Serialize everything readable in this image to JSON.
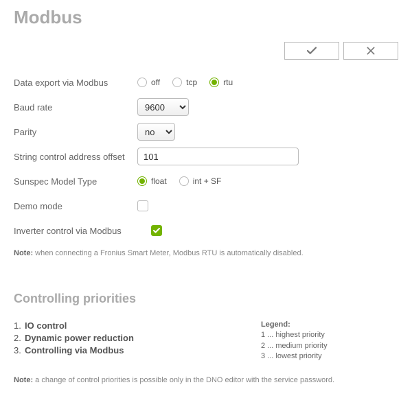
{
  "title": "Modbus",
  "toolbar": {
    "apply_label": "apply",
    "cancel_label": "cancel"
  },
  "form": {
    "data_export": {
      "label": "Data export via Modbus",
      "options": {
        "off": "off",
        "tcp": "tcp",
        "rtu": "rtu"
      },
      "value": "rtu"
    },
    "baud_rate": {
      "label": "Baud rate",
      "value": "9600"
    },
    "parity": {
      "label": "Parity",
      "value": "no"
    },
    "string_offset": {
      "label": "String control address offset",
      "value": "101"
    },
    "sunspec": {
      "label": "Sunspec Model Type",
      "options": {
        "float": "float",
        "intsf": "int + SF"
      },
      "value": "float"
    },
    "demo_mode": {
      "label": "Demo mode",
      "value": false
    },
    "inverter_control": {
      "label": "Inverter control via Modbus",
      "value": true
    },
    "note_prefix": "Note:",
    "note_text": " when connecting a Fronius Smart Meter, Modbus RTU is automatically disabled."
  },
  "priorities_section": {
    "heading": "Controlling priorities",
    "items": [
      {
        "num": "1.",
        "name": "IO control"
      },
      {
        "num": "2.",
        "name": "Dynamic power reduction"
      },
      {
        "num": "3.",
        "name": "Controlling via Modbus"
      }
    ],
    "legend": {
      "title": "Legend:",
      "l1": "1 ... highest priority",
      "l2": "2 ... medium priority",
      "l3": "3 ... lowest priority"
    },
    "note_prefix": "Note:",
    "note_text": " a change of control priorities is possible only in the DNO editor with the service password."
  }
}
